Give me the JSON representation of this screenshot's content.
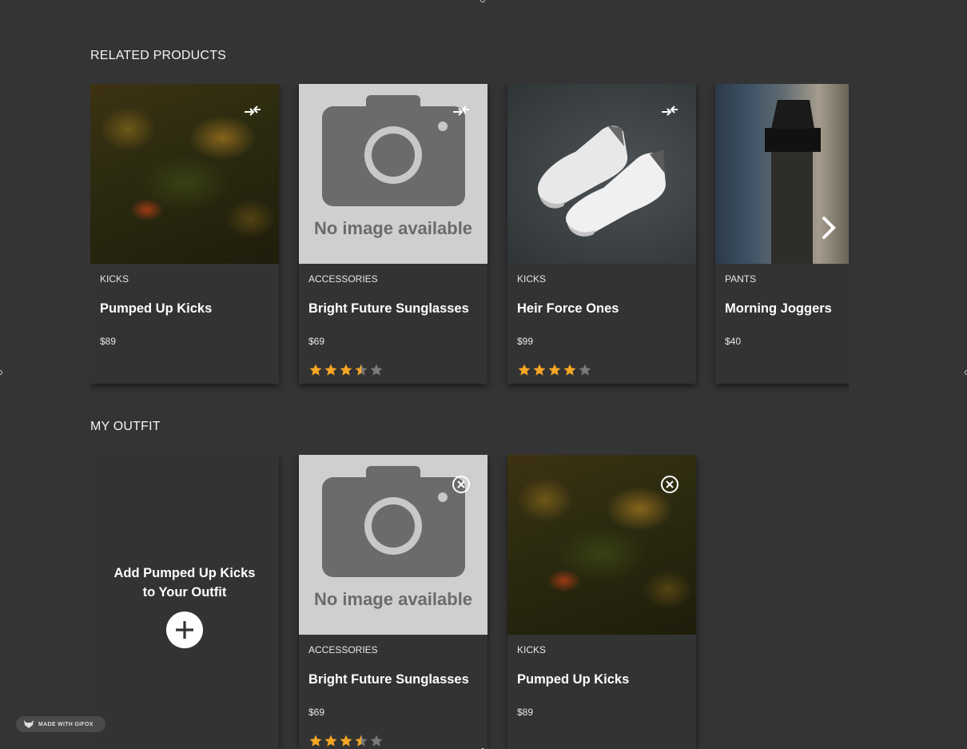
{
  "related": {
    "title": "RELATED PRODUCTS",
    "next_icon": "chevron-right-icon",
    "cards": [
      {
        "category": "KICKS",
        "name": "Pumped Up Kicks",
        "price": "$89",
        "image": "forest-sneakers-photo",
        "action_icon": "compare-icon",
        "rating": null
      },
      {
        "category": "ACCESSORIES",
        "name": "Bright Future Sunglasses",
        "price": "$69",
        "image": "no-image-placeholder",
        "action_icon": "compare-icon",
        "rating": 3.5
      },
      {
        "category": "KICKS",
        "name": "Heir Force Ones",
        "price": "$99",
        "image": "white-sneakers-photo",
        "action_icon": "compare-icon",
        "rating": 4
      },
      {
        "category": "PANTS",
        "name": "Morning Joggers",
        "price": "$40",
        "image": "joggers-photo",
        "rating": null
      }
    ]
  },
  "outfit": {
    "title": "MY OUTFIT",
    "add_card": {
      "line1": "Add Pumped Up Kicks",
      "line2": "to Your Outfit",
      "icon": "plus-circle-icon"
    },
    "cards": [
      {
        "category": "ACCESSORIES",
        "name": "Bright Future Sunglasses",
        "price": "$69",
        "image": "no-image-placeholder",
        "action_icon": "remove-circle-icon",
        "rating": 3.5
      },
      {
        "category": "KICKS",
        "name": "Pumped Up Kicks",
        "price": "$89",
        "image": "forest-sneakers-photo",
        "action_icon": "remove-circle-icon",
        "rating": null
      }
    ]
  },
  "placeholder": {
    "text": "No image available"
  },
  "badge": {
    "text": "MADE WITH GIFOX"
  },
  "colors": {
    "background": "#343434",
    "star_filled": "#f5a623",
    "star_empty": "#7a7a7a"
  }
}
